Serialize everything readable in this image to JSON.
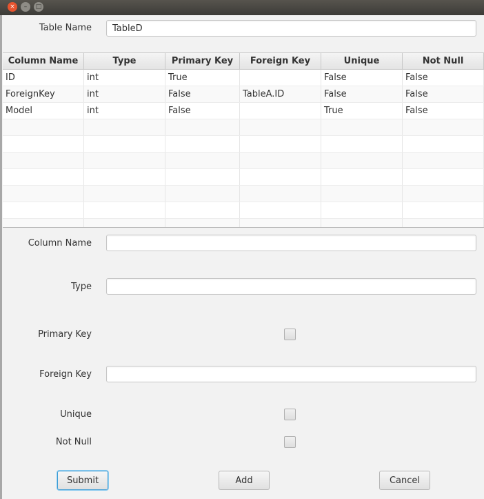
{
  "window": {
    "controls": {
      "close": "×",
      "minimize": "–",
      "maximize": "□"
    }
  },
  "table_name": {
    "label": "Table Name",
    "value": "TableD"
  },
  "table": {
    "headers": [
      "Column Name",
      "Type",
      "Primary Key",
      "Foreign Key",
      "Unique",
      "Not Null"
    ],
    "rows": [
      [
        "ID",
        "int",
        "True",
        "",
        "False",
        "False"
      ],
      [
        "ForeignKey",
        "int",
        "False",
        "TableA.ID",
        "False",
        "False"
      ],
      [
        "Model",
        "int",
        "False",
        "",
        "True",
        "False"
      ]
    ],
    "empty_rows": 7
  },
  "form": {
    "column_name": {
      "label": "Column Name",
      "value": ""
    },
    "type": {
      "label": "Type",
      "value": ""
    },
    "primary_key": {
      "label": "Primary Key",
      "checked": false
    },
    "foreign_key": {
      "label": "Foreign Key",
      "value": ""
    },
    "unique": {
      "label": "Unique",
      "checked": false
    },
    "not_null": {
      "label": "Not Null",
      "checked": false
    }
  },
  "buttons": {
    "submit": "Submit",
    "add": "Add",
    "cancel": "Cancel"
  },
  "colors": {
    "accent_focus": "#3a9bd5",
    "close_button": "#e8542f"
  }
}
